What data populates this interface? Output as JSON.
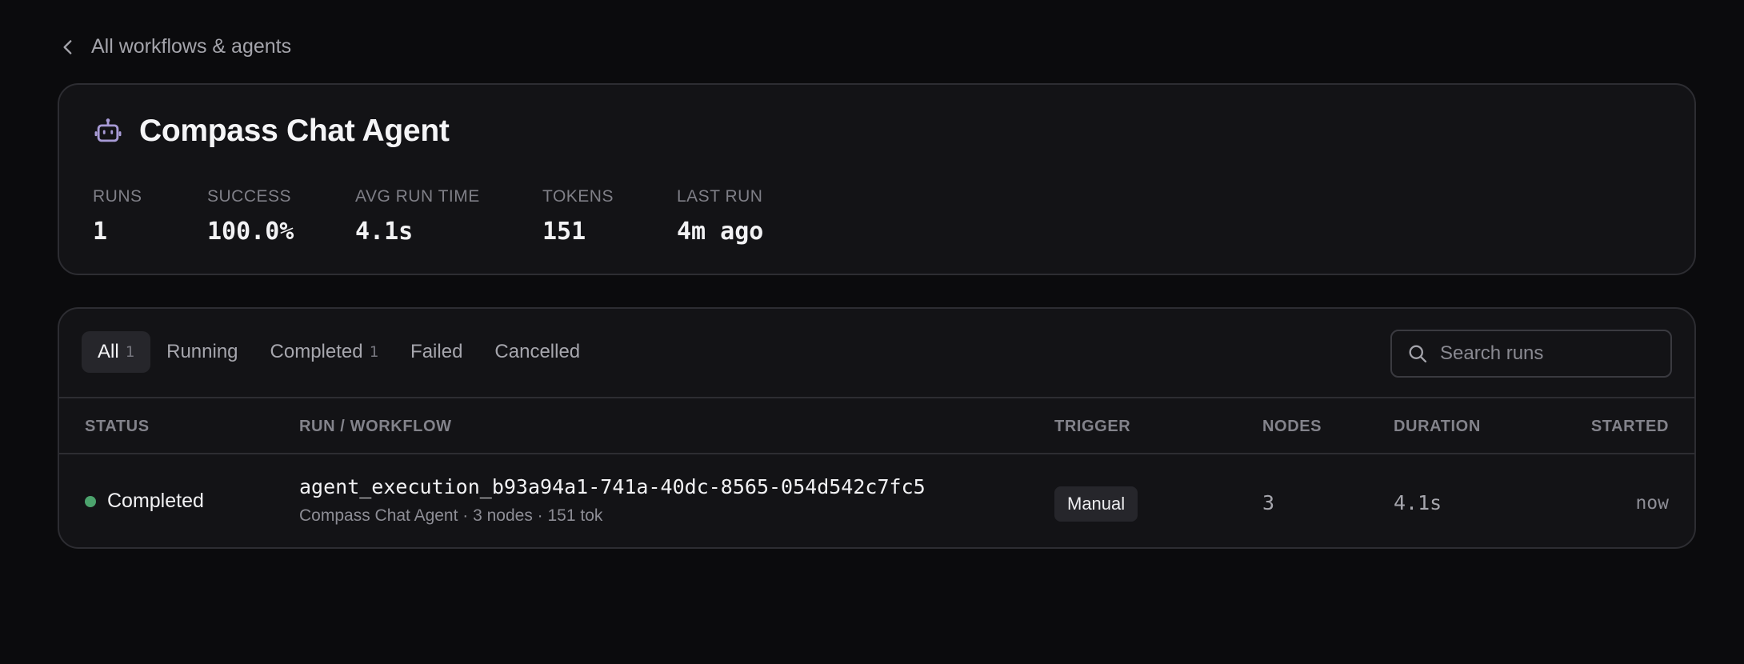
{
  "nav": {
    "back_label": "All workflows & agents"
  },
  "agent": {
    "title": "Compass Chat Agent",
    "icon": "robot-icon",
    "icon_color": "#a89bd6"
  },
  "stats": [
    {
      "label": "RUNS",
      "value": "1"
    },
    {
      "label": "SUCCESS",
      "value": "100.0%"
    },
    {
      "label": "AVG RUN TIME",
      "value": "4.1s"
    },
    {
      "label": "TOKENS",
      "value": "151"
    },
    {
      "label": "LAST RUN",
      "value": "4m ago"
    }
  ],
  "tabs": [
    {
      "label": "All",
      "count": "1",
      "active": true
    },
    {
      "label": "Running",
      "count": ""
    },
    {
      "label": "Completed",
      "count": "1"
    },
    {
      "label": "Failed",
      "count": ""
    },
    {
      "label": "Cancelled",
      "count": ""
    }
  ],
  "search": {
    "placeholder": "Search runs"
  },
  "table": {
    "columns": [
      "STATUS",
      "RUN / WORKFLOW",
      "TRIGGER",
      "NODES",
      "DURATION",
      "STARTED"
    ],
    "rows": [
      {
        "status": "Completed",
        "status_color": "#4ca36d",
        "run_id": "agent_execution_b93a94a1-741a-40dc-8565-054d542c7fc5",
        "run_sub": "Compass Chat Agent · 3 nodes · 151 tok",
        "trigger": "Manual",
        "nodes": "3",
        "duration": "4.1s",
        "started": "now"
      }
    ]
  }
}
